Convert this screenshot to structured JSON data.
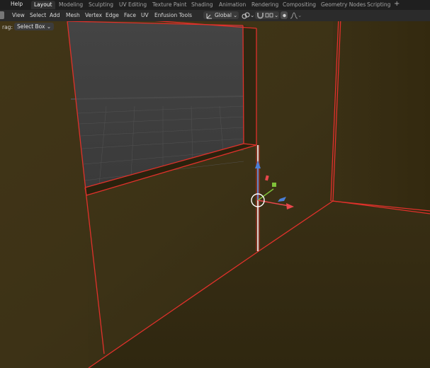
{
  "topbar": {
    "help_label": "Help",
    "workspaces": [
      "Layout",
      "Modeling",
      "Sculpting",
      "UV Editing",
      "Texture Paint",
      "Shading",
      "Animation",
      "Rendering",
      "Compositing",
      "Geometry Nodes",
      "Scripting"
    ],
    "active_workspace": "Layout",
    "add_label": "+"
  },
  "header": {
    "menus": [
      "View",
      "Select",
      "Add",
      "Mesh",
      "Vertex",
      "Edge",
      "Face",
      "UV",
      "Enfusion Tools"
    ],
    "transform_orientation": "Global",
    "orientation_icon": "axes-icon",
    "pivot_icon": "pivot-link-icon",
    "snap_icon": "magnet-icon",
    "proportional_icon": "proportional-falloff-icon"
  },
  "tool_header": {
    "drag_label": "rag:",
    "drag_value": "Select Box"
  },
  "colors": {
    "viewport_wall": "#3b3116",
    "window_interior": "#4a4a4a",
    "selected_edge": "#e0312b",
    "active_edge": "#ffffff",
    "gizmo_x": "#e8474c",
    "gizmo_y": "#7fc23a",
    "gizmo_z": "#4a7fd8"
  }
}
